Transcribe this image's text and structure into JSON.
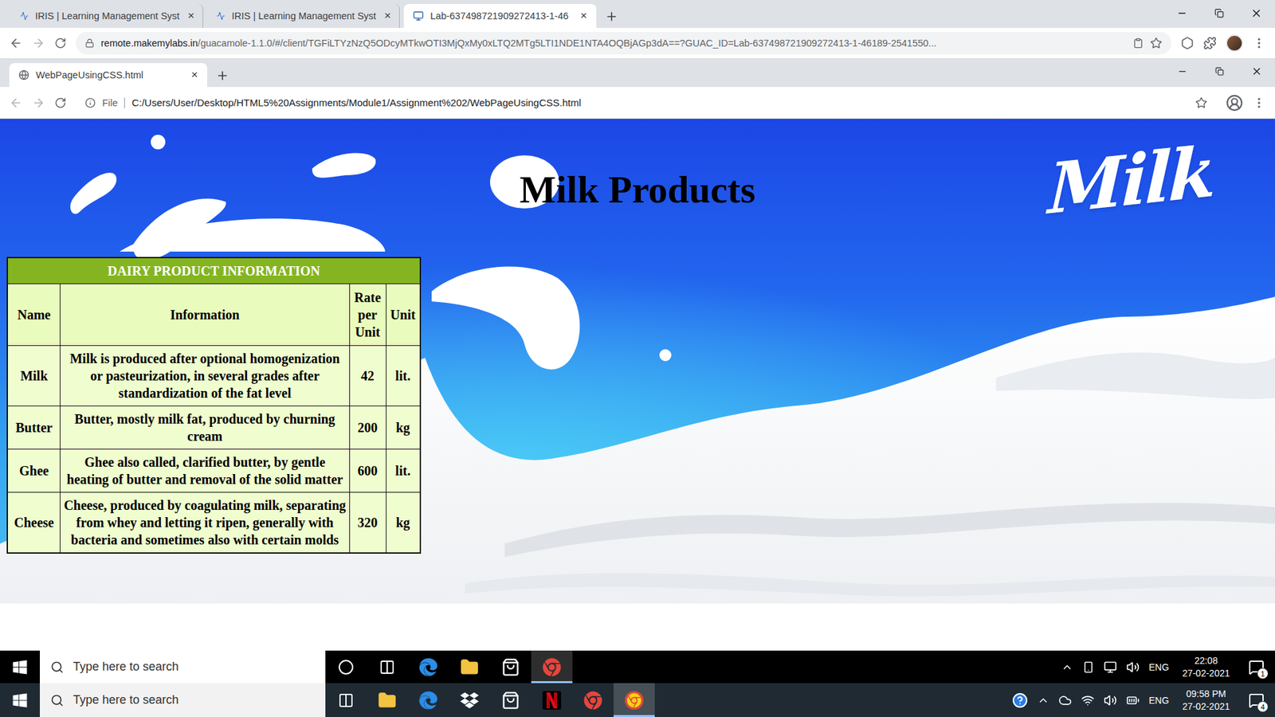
{
  "outer_browser": {
    "tabs": [
      {
        "label": "IRIS | Learning Management Syst",
        "close": "×",
        "selected": false,
        "kind": "iris"
      },
      {
        "label": "IRIS | Learning Management Syst",
        "close": "×",
        "selected": false,
        "kind": "iris"
      },
      {
        "label": "Lab-637498721909272413-1-46",
        "close": "×",
        "selected": true,
        "kind": "lab"
      }
    ],
    "url_domain": "remote.makemylabs.in",
    "url_path": "/guacamole-1.1.0/#/client/TGFiLTYzNzQ5ODcyMTkwOTI3MjQxMy0xLTQ2MTg5LTI1NDE1NTA4OQBjAGp3dA==?GUAC_ID=Lab-637498721909272413-1-46189-2541550..."
  },
  "inner_browser": {
    "tabs": [
      {
        "label": "WebPageUsingCSS.html",
        "close": "×",
        "selected": true
      }
    ],
    "file_label": "File",
    "url": "C:/Users/User/Desktop/HTML5%20Assignments/Module1/Assignment%202/WebPageUsingCSS.html"
  },
  "page": {
    "heading": "Milk Products",
    "logo": "Milk",
    "table": {
      "caption": "DAIRY PRODUCT INFORMATION",
      "columns": [
        "Name",
        "Information",
        "Rate per Unit",
        "Unit"
      ],
      "rows": [
        [
          "Milk",
          "Milk is produced after optional homogenization or pasteurization, in several grades after standardization of the fat level",
          "42",
          "lit."
        ],
        [
          "Butter",
          "Butter, mostly milk fat, produced by churning cream",
          "200",
          "kg"
        ],
        [
          "Ghee",
          "Ghee also called, clarified butter, by gentle heating of butter and removal of the solid matter",
          "600",
          "lit."
        ],
        [
          "Cheese",
          "Cheese, produced by coagulating milk, separating from whey and letting it ripen, generally with bacteria and sometimes also with certain molds",
          "320",
          "kg"
        ]
      ]
    }
  },
  "inner_taskbar": {
    "search_placeholder": "Type here to search",
    "apps": [
      {
        "kind": "cortana",
        "selected": false
      },
      {
        "kind": "taskview",
        "selected": false
      },
      {
        "kind": "edge",
        "selected": false
      },
      {
        "kind": "explorer",
        "selected": false
      },
      {
        "kind": "store",
        "selected": false
      },
      {
        "kind": "chrome",
        "selected": true
      }
    ],
    "language": "ENG",
    "time": "22:08",
    "date": "27-02-2021",
    "notifications": "1"
  },
  "outer_taskbar": {
    "search_placeholder": "Type here to search",
    "apps": [
      {
        "kind": "taskview",
        "selected": false
      },
      {
        "kind": "explorer",
        "selected": false
      },
      {
        "kind": "edge",
        "selected": false
      },
      {
        "kind": "dropbox",
        "selected": false
      },
      {
        "kind": "store",
        "selected": false
      },
      {
        "kind": "netflix",
        "selected": false
      },
      {
        "kind": "chrome",
        "selected": false
      },
      {
        "kind": "remote",
        "selected": true
      }
    ],
    "language": "ENG",
    "time": "09:58 PM",
    "date": "27-02-2021",
    "notifications": "4"
  }
}
